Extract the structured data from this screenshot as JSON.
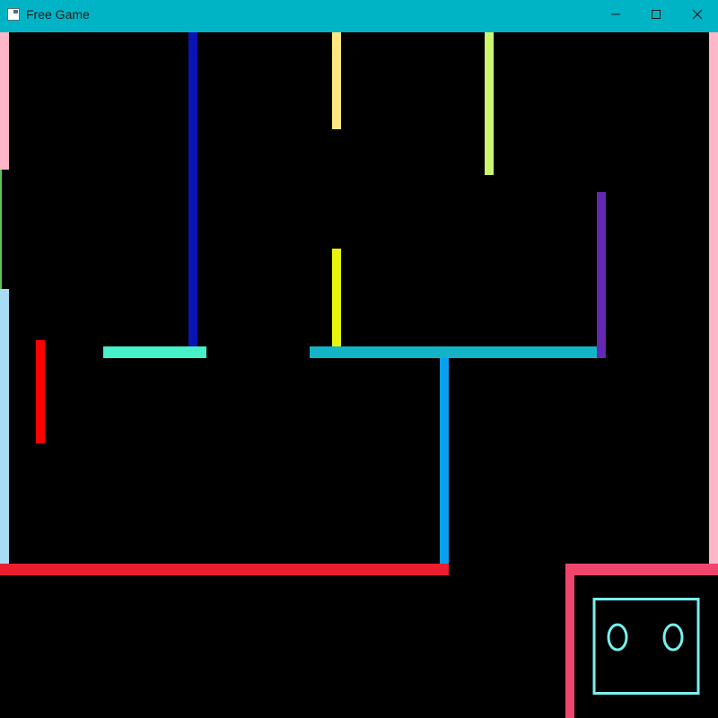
{
  "window": {
    "title": "Free Game",
    "titlebar_color": "#00b4c6",
    "controls": [
      "minimize-icon",
      "maximize-icon",
      "close-icon"
    ]
  },
  "game": {
    "background": "#000000",
    "walls": [
      {
        "name": "left-wall-pink",
        "color": "#ffb6c8"
      },
      {
        "name": "left-wall-green",
        "color": "#5cc35c"
      },
      {
        "name": "left-wall-lightblue",
        "color": "#a8dcf5"
      },
      {
        "name": "right-wall-pink",
        "color": "#ffb6c8"
      },
      {
        "name": "vertical-wall-navy",
        "color": "#0a14b4"
      },
      {
        "name": "vertical-wall-yellow-top",
        "color": "#ffe680"
      },
      {
        "name": "vertical-wall-lime-top",
        "color": "#ccf56e"
      },
      {
        "name": "vertical-wall-yellow-mid",
        "color": "#e6f50a"
      },
      {
        "name": "vertical-wall-purple",
        "color": "#6428b4"
      },
      {
        "name": "vertical-wall-red",
        "color": "#ff0000"
      },
      {
        "name": "horizontal-wall-aqua",
        "color": "#46f0c8"
      },
      {
        "name": "horizontal-wall-teal",
        "color": "#14b4c8"
      },
      {
        "name": "vertical-wall-blue",
        "color": "#0aa0f0"
      },
      {
        "name": "horizontal-wall-red-floor",
        "color": "#eb1e2d"
      },
      {
        "name": "player-box-top-wall",
        "color": "#f0466e"
      },
      {
        "name": "player-box-left-wall",
        "color": "#f0466e"
      }
    ],
    "player": {
      "outline_color": "#78f0f0",
      "eyes": 2
    }
  }
}
